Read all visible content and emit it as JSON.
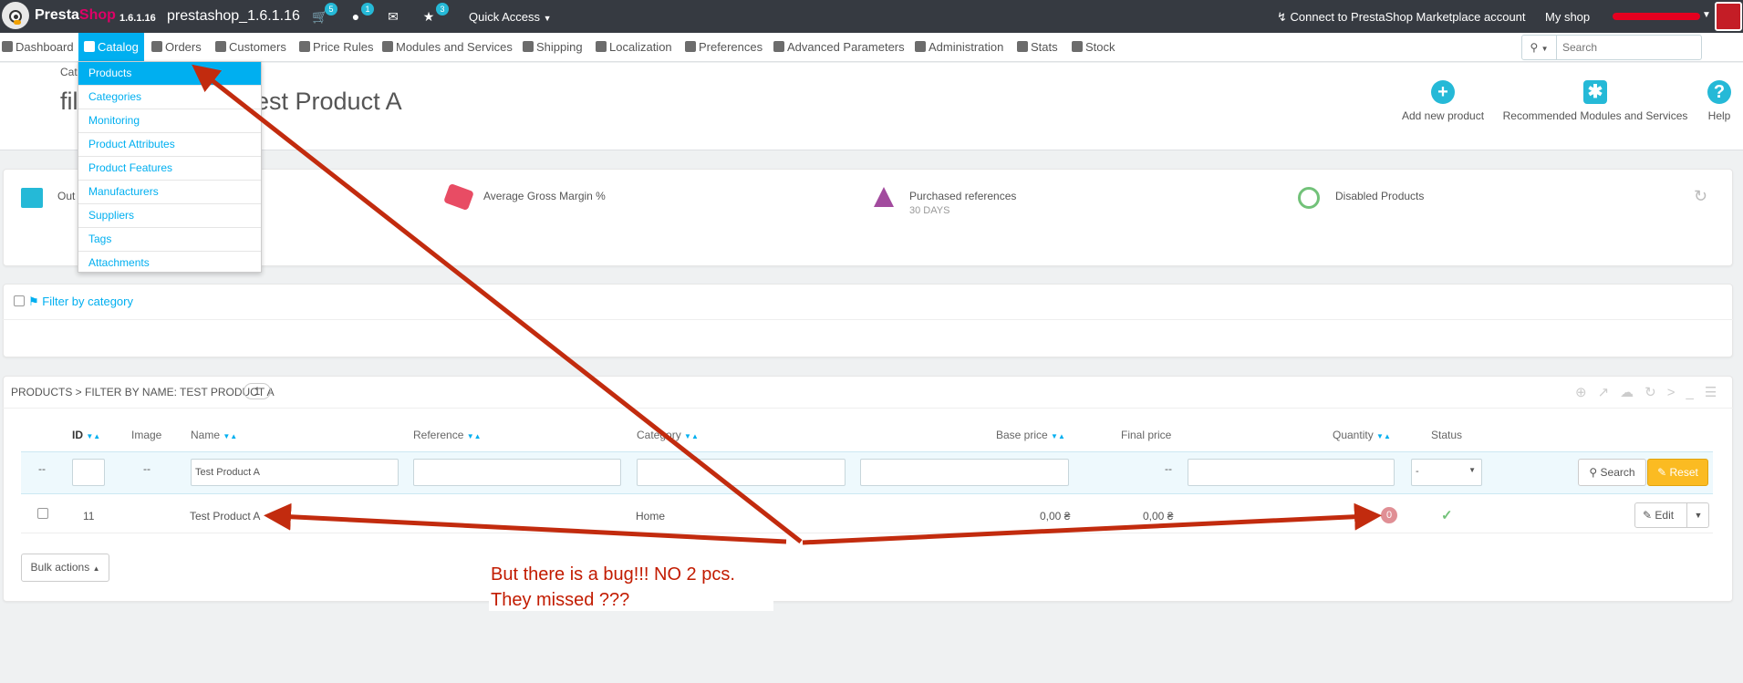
{
  "header": {
    "brand_presta": "Presta",
    "brand_shop": "Shop",
    "version": "1.6.1.16",
    "shop_name": "prestashop_1.6.1.16",
    "orders_badge": "5",
    "customers_badge": "1",
    "trophy_badge": "3",
    "quick_access": "Quick Access",
    "connect": "Connect to PrestaShop Marketplace account",
    "my_shop": "My shop"
  },
  "nav": {
    "items": [
      "Dashboard",
      "Catalog",
      "Orders",
      "Customers",
      "Price Rules",
      "Modules and Services",
      "Shipping",
      "Localization",
      "Preferences",
      "Advanced Parameters",
      "Administration",
      "Stats",
      "Stock"
    ]
  },
  "search": {
    "placeholder": "Search"
  },
  "page": {
    "breadcrumb": "Cat",
    "title_left": "fil",
    "title_right": "est Product A"
  },
  "toolbar": {
    "add_new": "Add new product",
    "recommended": "Recommended Modules and Services",
    "help": "Help"
  },
  "catalog_menu": [
    "Products",
    "Categories",
    "Monitoring",
    "Product Attributes",
    "Product Features",
    "Manufacturers",
    "Suppliers",
    "Tags",
    "Attachments"
  ],
  "kpi": {
    "out_of_stock": "Out",
    "avg_margin": "Average Gross Margin %",
    "purchased": "Purchased references",
    "purchased_sub": "30 DAYS",
    "disabled": "Disabled Products"
  },
  "filter_category": "Filter by category",
  "list": {
    "heading": "PRODUCTS > FILTER BY NAME: TEST PRODUCT A",
    "count": "1",
    "columns": [
      "ID",
      "Image",
      "Name",
      "Reference",
      "Category",
      "Base price",
      "Final price",
      "Quantity",
      "Status"
    ],
    "filter_row": {
      "id_dash": "--",
      "image_dash": "--",
      "name_value": "Test Product A",
      "final_dash": "--",
      "status_value": "-",
      "search_label": "Search",
      "reset_label": "Reset"
    },
    "rows": [
      {
        "id": "11",
        "name": "Test Product A",
        "category": "Home",
        "base_price": "0,00 ₴",
        "final_price": "0,00 ₴",
        "quantity": "0",
        "edit_label": "Edit"
      }
    ],
    "bulk_actions": "Bulk actions"
  },
  "annotation": {
    "line1": "But there is a bug!!! NO 2 pcs.",
    "line2": "They missed ???"
  },
  "colors": {
    "accent": "#00aff0",
    "header_bg": "#363a41",
    "reset_btn": "#fbbb22",
    "arrow": "#c22b0e",
    "status_ok": "#72c279"
  }
}
